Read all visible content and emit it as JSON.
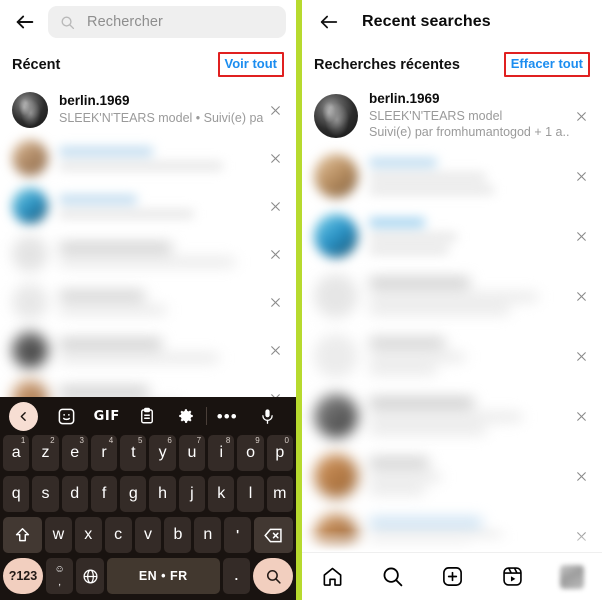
{
  "meta": {
    "divider_color": "#b7da2e",
    "accent_blue": "#1b8df0",
    "highlight_red": "#e02020"
  },
  "left_panel": {
    "back_icon": "back-arrow-icon",
    "search": {
      "icon": "search-icon",
      "placeholder": "Rechercher",
      "value": ""
    },
    "section": {
      "title": "Récent",
      "action_label": "Voir tout",
      "action_highlighted": true
    },
    "rows": [
      {
        "username": "berlin.1969",
        "subtitle": "SLEEK'N'TEARS model • Suivi(e) par fro...",
        "blurred": false,
        "close_icon": "close-icon"
      },
      {
        "username": "",
        "subtitle": "",
        "blurred": true,
        "close_icon": "close-icon"
      },
      {
        "username": "",
        "subtitle": "",
        "blurred": true,
        "close_icon": "close-icon"
      },
      {
        "username": "",
        "subtitle": "",
        "blurred": true,
        "close_icon": "close-icon"
      },
      {
        "username": "",
        "subtitle": "",
        "blurred": true,
        "close_icon": "close-icon"
      },
      {
        "username": "",
        "subtitle": "",
        "blurred": true,
        "close_icon": "close-icon"
      },
      {
        "username": "",
        "subtitle": "",
        "blurred": true,
        "close_icon": "close-icon"
      }
    ],
    "keyboard": {
      "toolbar": [
        {
          "name": "collapse-toolbar-button",
          "glyph": "‹"
        },
        {
          "name": "sticker-icon",
          "glyph": "sticker"
        },
        {
          "name": "gif-button",
          "glyph": "GIF"
        },
        {
          "name": "clipboard-icon",
          "glyph": "clipboard"
        },
        {
          "name": "settings-gear-icon",
          "glyph": "gear"
        },
        {
          "name": "more-options-icon",
          "glyph": "•••"
        },
        {
          "name": "microphone-icon",
          "glyph": "mic"
        }
      ],
      "row1": [
        {
          "key": "a",
          "num": "1"
        },
        {
          "key": "z",
          "num": "2"
        },
        {
          "key": "e",
          "num": "3"
        },
        {
          "key": "r",
          "num": "4"
        },
        {
          "key": "t",
          "num": "5"
        },
        {
          "key": "y",
          "num": "6"
        },
        {
          "key": "u",
          "num": "7"
        },
        {
          "key": "i",
          "num": "8"
        },
        {
          "key": "o",
          "num": "9"
        },
        {
          "key": "p",
          "num": "0"
        }
      ],
      "row2": [
        "q",
        "s",
        "d",
        "f",
        "g",
        "h",
        "j",
        "k",
        "l",
        "m"
      ],
      "row3": {
        "shift_label": "shift-key",
        "keys": [
          "w",
          "x",
          "c",
          "v",
          "b",
          "n",
          "'"
        ],
        "backspace_label": "backspace-key"
      },
      "row4": {
        "symbols_label": "?123",
        "emoji_top": "☺",
        "emoji_bottom": ",",
        "globe_label": "globe-key",
        "space_label": "EN • FR",
        "period_label": ".",
        "search_label": "search-key"
      }
    }
  },
  "right_panel": {
    "back_icon": "back-arrow-icon",
    "title": "Recent searches",
    "section": {
      "title": "Recherches récentes",
      "action_label": "Effacer tout",
      "action_highlighted": true
    },
    "rows": [
      {
        "username": "berlin.1969",
        "subtitle1": "SLEEK'N'TEARS model",
        "subtitle2": "Suivi(e) par fromhumantogod + 1 a...",
        "blurred": false,
        "close_icon": "close-icon"
      },
      {
        "username": "",
        "subtitle1": "",
        "subtitle2": "",
        "blurred": true,
        "close_icon": "close-icon"
      },
      {
        "username": "",
        "subtitle1": "",
        "subtitle2": "",
        "blurred": true,
        "close_icon": "close-icon"
      },
      {
        "username": "",
        "subtitle1": "",
        "subtitle2": "",
        "blurred": true,
        "close_icon": "close-icon"
      },
      {
        "username": "",
        "subtitle1": "",
        "subtitle2": "",
        "blurred": true,
        "close_icon": "close-icon"
      },
      {
        "username": "",
        "subtitle1": "",
        "subtitle2": "",
        "blurred": true,
        "close_icon": "close-icon"
      },
      {
        "username": "",
        "subtitle1": "",
        "subtitle2": "",
        "blurred": true,
        "close_icon": "close-icon"
      },
      {
        "username": "",
        "subtitle1": "",
        "subtitle2": "",
        "blurred": true,
        "close_icon": "close-icon"
      }
    ],
    "bottom_nav": [
      {
        "name": "nav-home",
        "icon": "home-icon"
      },
      {
        "name": "nav-search",
        "icon": "search-icon"
      },
      {
        "name": "nav-create",
        "icon": "plus-square-icon"
      },
      {
        "name": "nav-reels",
        "icon": "reels-icon"
      },
      {
        "name": "nav-profile",
        "icon": "profile-avatar"
      }
    ]
  }
}
